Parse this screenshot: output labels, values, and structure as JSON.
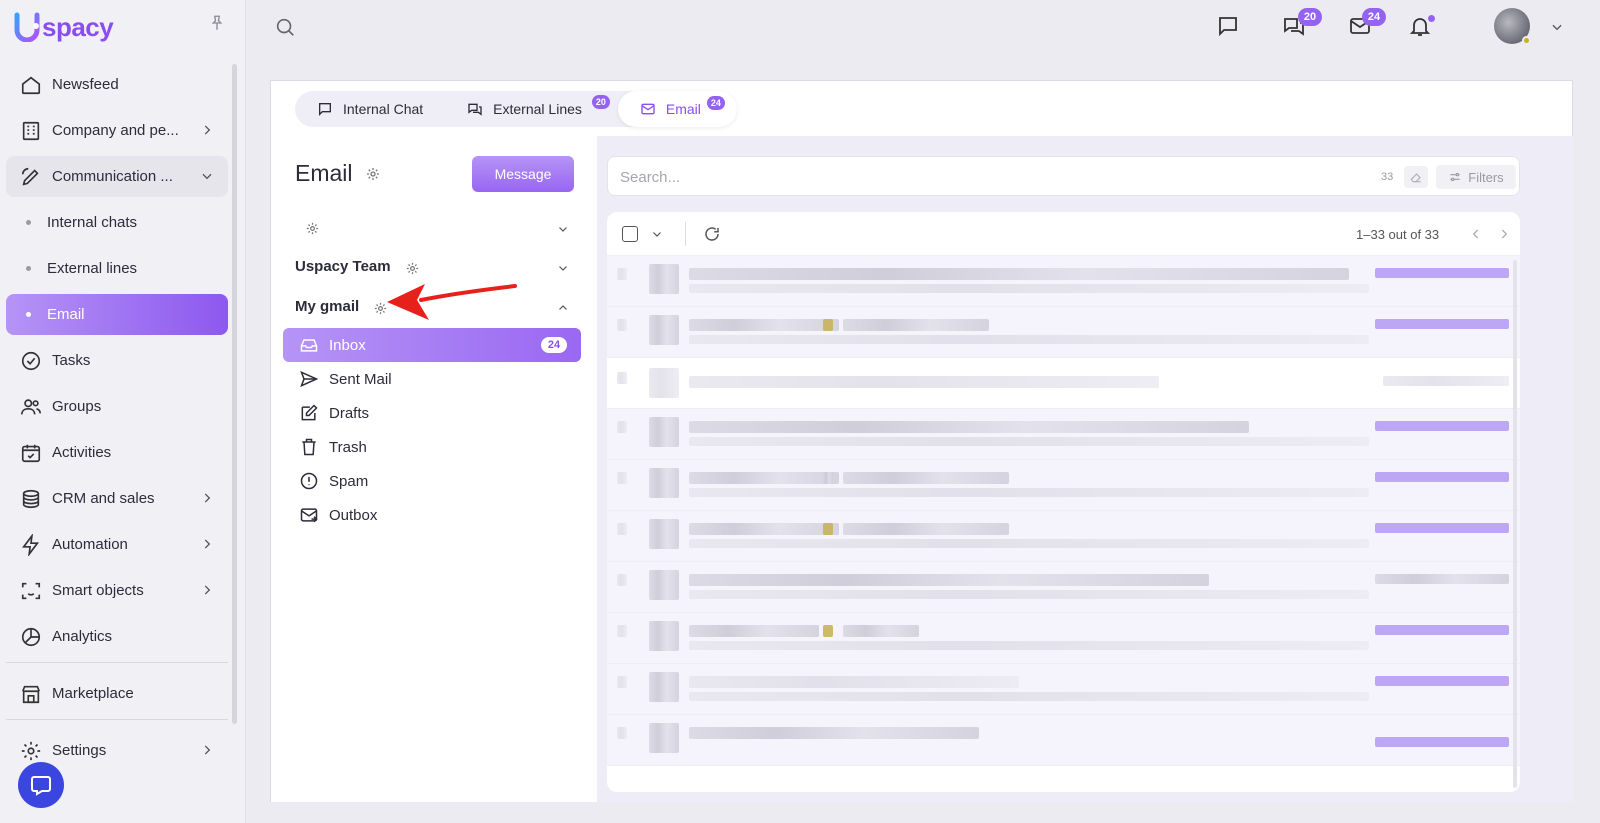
{
  "app": {
    "brand": "spacy",
    "accent": "#8a4df0"
  },
  "sidebar": {
    "items": [
      {
        "label": "Newsfeed",
        "icon": "home-icon"
      },
      {
        "label": "Company and pe...",
        "icon": "building-icon"
      },
      {
        "label": "Communication ...",
        "icon": "pen-chat-icon"
      },
      {
        "label": "Tasks",
        "icon": "check-circle-icon"
      },
      {
        "label": "Groups",
        "icon": "users-icon"
      },
      {
        "label": "Activities",
        "icon": "calendar-check-icon"
      },
      {
        "label": "CRM and sales",
        "icon": "coins-stack-icon"
      },
      {
        "label": "Automation",
        "icon": "lightning-icon"
      },
      {
        "label": "Smart objects",
        "icon": "scan-face-icon"
      },
      {
        "label": "Analytics",
        "icon": "pie-chart-icon"
      },
      {
        "label": "Marketplace",
        "icon": "storefront-icon"
      },
      {
        "label": "Settings",
        "icon": "gear-icon"
      }
    ],
    "sub_items": [
      {
        "label": "Internal chats"
      },
      {
        "label": "External lines"
      },
      {
        "label": "Email"
      }
    ]
  },
  "topbar": {
    "external_badge": "20",
    "email_badge": "24"
  },
  "tabs": [
    {
      "label": "Internal Chat"
    },
    {
      "label": "External Lines",
      "badge": "20"
    },
    {
      "label": "Email",
      "badge": "24"
    }
  ],
  "mail": {
    "title": "Email",
    "message_button": "Message",
    "accounts": [
      {
        "label": ""
      },
      {
        "label": "Uspacy Team"
      },
      {
        "label": "My gmail"
      }
    ],
    "folders": [
      {
        "label": "Inbox",
        "count": "24"
      },
      {
        "label": "Sent Mail"
      },
      {
        "label": "Drafts"
      },
      {
        "label": "Trash"
      },
      {
        "label": "Spam"
      },
      {
        "label": "Outbox"
      }
    ]
  },
  "list": {
    "search_placeholder": "Search...",
    "search_count": "33",
    "filters_label": "Filters",
    "pager": "1–33 out of 33"
  }
}
